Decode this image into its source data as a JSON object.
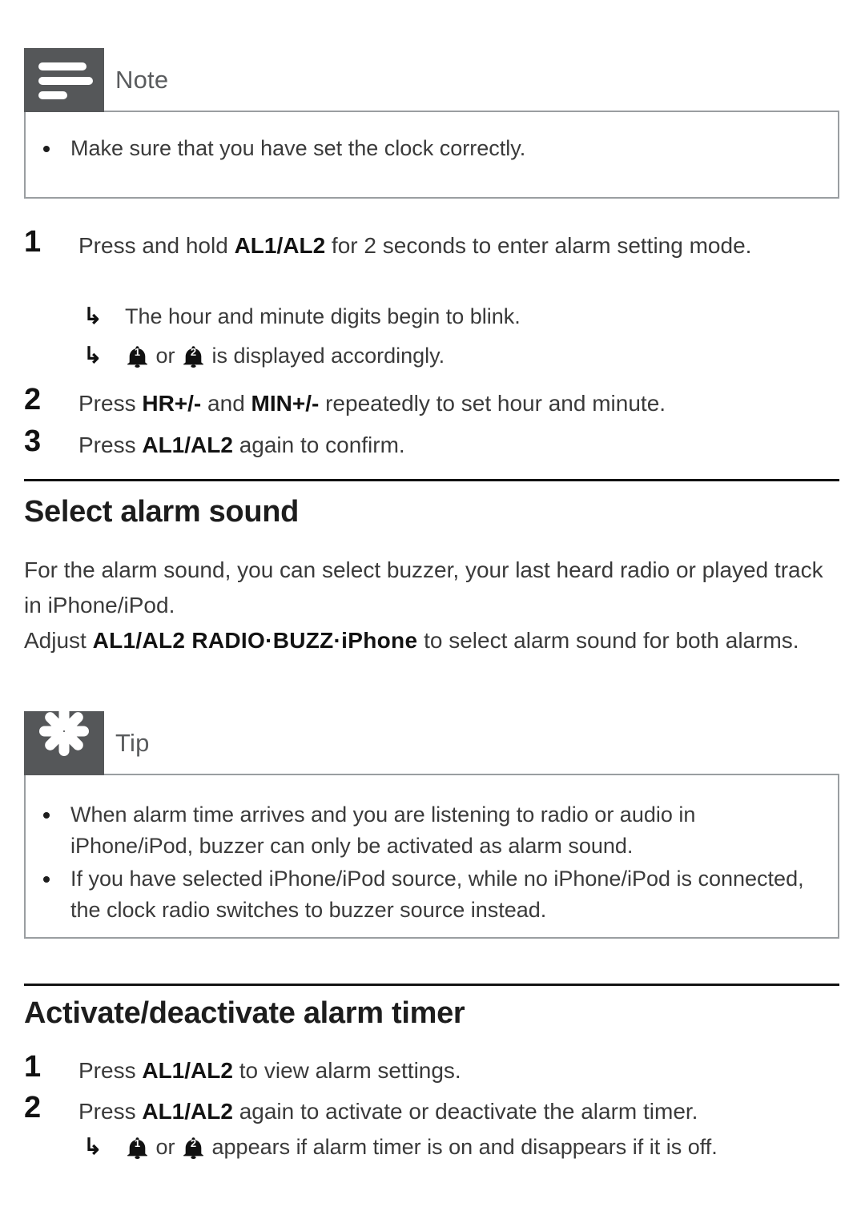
{
  "note_box": {
    "icon": "note-lines-icon",
    "title": "Note",
    "bullets": [
      "Make sure that you have set the clock correctly."
    ]
  },
  "alarm_setting_steps": [
    {
      "number": "1",
      "text_before": "Press and hold ",
      "bold": "AL1/AL2",
      "text_after": " for 2 seconds to enter alarm setting mode."
    },
    {
      "number": "2",
      "text_before": "Press ",
      "bold": "HR+/-",
      "mid": " and ",
      "bold2": "MIN+/-",
      "text_after": " repeatedly to set hour and minute."
    },
    {
      "number": "3",
      "text_before": "Press ",
      "bold": "AL1/AL2",
      "text_after": " again to confirm."
    }
  ],
  "alarm_setting_subitems": [
    {
      "arrow": "↳",
      "text": "The hour and minute digits begin to blink."
    },
    {
      "arrow": "↳",
      "bell1": "1",
      "mid": " or ",
      "bell2": "2",
      "text": " is displayed accordingly."
    }
  ],
  "select_alarm_sound": {
    "heading": "Select alarm sound",
    "paragraph1": "For the alarm sound, you can select buzzer, your last heard radio or played track in iPhone/iPod.",
    "paragraph2_before": "Adjust ",
    "paragraph2_bold": "AL1/AL2 RADIO·BUZZ·iPhone",
    "paragraph2_after": "  to select alarm sound for both alarms."
  },
  "tip_box": {
    "icon": "starburst-icon",
    "title": "Tip",
    "bullets": [
      "When alarm time arrives and you are listening to radio or audio in iPhone/iPod, buzzer can only be activated as alarm sound.",
      "If you have selected iPhone/iPod source, while no iPhone/iPod is connected, the clock radio switches to buzzer source instead."
    ]
  },
  "activate_deactivate": {
    "heading": "Activate/deactivate alarm timer",
    "steps": [
      {
        "number": "1",
        "text_before": "Press ",
        "bold": "AL1/AL2",
        "text_after": " to view alarm settings."
      },
      {
        "number": "2",
        "text_before": "Press ",
        "bold": "AL1/AL2",
        "text_after": " again to activate or deactivate the alarm timer."
      }
    ],
    "subitem": {
      "arrow": "↳",
      "bell1": "1",
      "mid": " or ",
      "bell2": "2",
      "text": " appears if alarm timer is on and disappears if it is off."
    }
  },
  "colors": {
    "callout_badge": "#555759",
    "callout_border": "#9a9ea1",
    "rule": "#121212",
    "body_text": "#3a3a3a",
    "heading_text": "#1d1d1d"
  }
}
